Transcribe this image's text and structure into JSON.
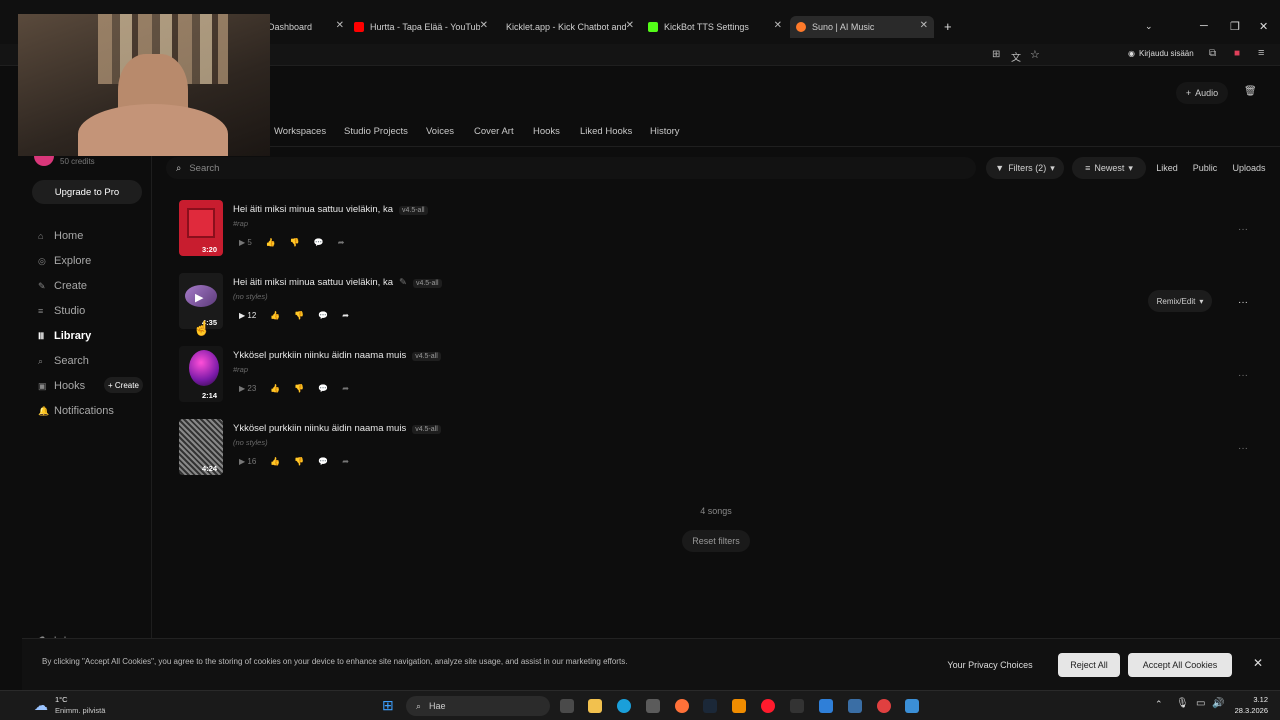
{
  "browser": {
    "tabs": [
      {
        "label": "Dashboard",
        "color": "#6a6a6a"
      },
      {
        "label": "Hurtta - Tapa Elää - YouTube",
        "color": "#ff0000"
      },
      {
        "label": "Kicklet.app - Kick Chatbot and C",
        "color": "#5ad65a"
      },
      {
        "label": "KickBot TTS Settings",
        "color": "#53fc18"
      },
      {
        "label": "Suno | AI Music",
        "color": "#ff7a2a"
      }
    ],
    "signin_label": "Kirjaudu sisään"
  },
  "header": {
    "audio_button": "Audio",
    "tabs": [
      "Workspaces",
      "Studio Projects",
      "Voices",
      "Cover Art",
      "Hooks",
      "Liked Hooks",
      "History"
    ]
  },
  "sidebar": {
    "credits": "50 credits",
    "upgrade": "Upgrade to Pro",
    "items": [
      {
        "label": "Home",
        "icon": "home-icon"
      },
      {
        "label": "Explore",
        "icon": "compass-icon"
      },
      {
        "label": "Create",
        "icon": "create-icon"
      },
      {
        "label": "Studio",
        "icon": "studio-icon"
      },
      {
        "label": "Library",
        "icon": "library-icon"
      },
      {
        "label": "Search",
        "icon": "search-icon"
      },
      {
        "label": "Hooks",
        "icon": "hooks-icon"
      },
      {
        "label": "Notifications",
        "icon": "bell-icon"
      }
    ],
    "hooks_create": "+ Create",
    "labs": "Labs"
  },
  "toolbar": {
    "search_placeholder": "Search",
    "filters": "Filters (2)",
    "sort": "Newest",
    "liked": "Liked",
    "public": "Public",
    "uploads": "Uploads"
  },
  "songs": [
    {
      "title": "Hei äiti miksi minua sattuu vieläkin, ka",
      "version": "v4.5-all",
      "style": "#rap",
      "duration": "3:20",
      "plays": "5"
    },
    {
      "title": "Hei äiti miksi minua sattuu vieläkin, ka",
      "version": "v4.5-all",
      "style": "(no styles)",
      "duration": "4:35",
      "plays": "12",
      "remix": "Remix/Edit"
    },
    {
      "title": "Ykkösel purkkiin niinku äidin naama muis",
      "version": "v4.5-all",
      "style": "#rap",
      "duration": "2:14",
      "plays": "23"
    },
    {
      "title": "Ykkösel purkkiin niinku äidin naama muis",
      "version": "v4.5-all",
      "style": "(no styles)",
      "duration": "4:24",
      "plays": "16"
    }
  ],
  "footer": {
    "count": "4 songs",
    "reset": "Reset filters"
  },
  "cookie": {
    "text": "By clicking \"Accept All Cookies\", you agree to the storing of cookies on your device to enhance site navigation, analyze site usage, and assist in our marketing efforts.",
    "privacy": "Your Privacy Choices",
    "reject": "Reject All",
    "accept": "Accept All Cookies"
  },
  "taskbar": {
    "weather_temp": "1°C",
    "weather_desc": "Enimm. pilvistä",
    "search": "Hae",
    "time": "3.12",
    "date": "28.3.2026"
  }
}
